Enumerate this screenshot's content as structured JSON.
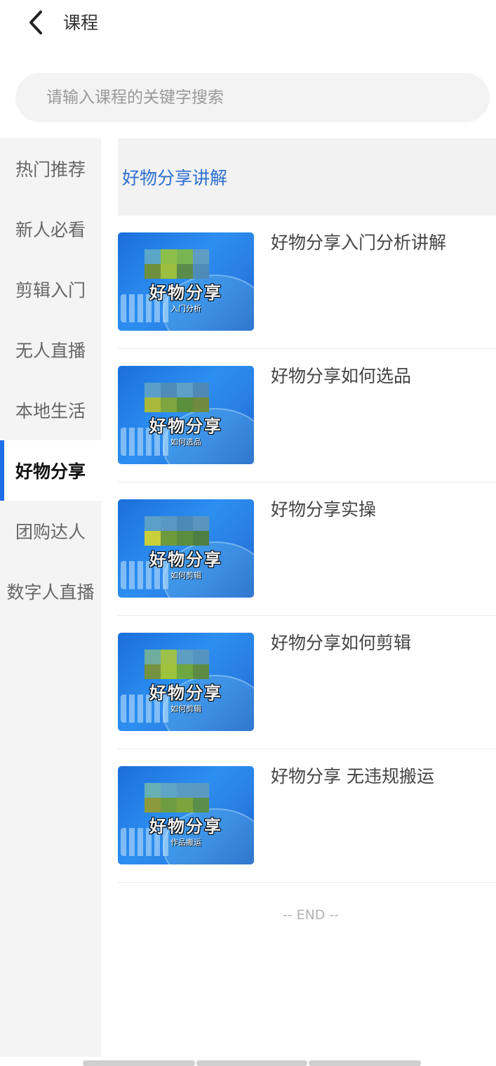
{
  "header": {
    "title": "课程",
    "back_icon": "chevron-left-icon"
  },
  "search": {
    "placeholder": "请输入课程的关键字搜索",
    "value": ""
  },
  "sidebar": {
    "items": [
      {
        "label": "热门推荐",
        "active": false
      },
      {
        "label": "新人必看",
        "active": false
      },
      {
        "label": "剪辑入门",
        "active": false
      },
      {
        "label": "无人直播",
        "active": false
      },
      {
        "label": "本地生活",
        "active": false
      },
      {
        "label": "好物分享",
        "active": true
      },
      {
        "label": "团购达人",
        "active": false
      },
      {
        "label": "数字人直播",
        "active": false
      }
    ]
  },
  "section": {
    "title": "好物分享讲解"
  },
  "courses": [
    {
      "title": "好物分享入门分析讲解",
      "thumb_title": "好物分享",
      "thumb_sub": "入门分析"
    },
    {
      "title": "好物分享如何选品",
      "thumb_title": "好物分享",
      "thumb_sub": "如何选品"
    },
    {
      "title": "好物分享实操",
      "thumb_title": "好物分享",
      "thumb_sub": "如何剪辑"
    },
    {
      "title": "好物分享如何剪辑",
      "thumb_title": "好物分享",
      "thumb_sub": "如何剪辑"
    },
    {
      "title": "好物分享 无违规搬运",
      "thumb_title": "好物分享",
      "thumb_sub": "作品搬运"
    }
  ],
  "footer": {
    "end_text": "-- END --"
  },
  "colors": {
    "accent": "#1e6fe8",
    "section_title": "#2d6fd1",
    "sidebar_bg": "#f4f4f4"
  }
}
